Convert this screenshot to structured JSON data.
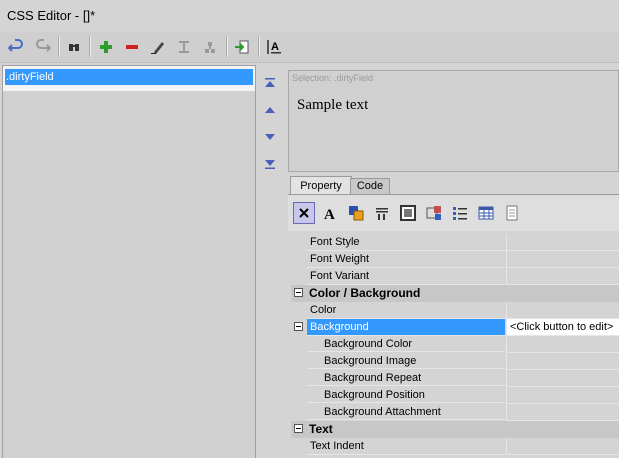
{
  "window": {
    "title": "CSS Editor - []*"
  },
  "toolbar": {
    "buttons": [
      "undo-icon",
      "redo-icon",
      "binoculars-icon",
      "add-icon",
      "remove-icon",
      "edit-icon",
      "tree-icon",
      "tree-disabled-icon",
      "import-icon",
      "font-style-icon"
    ]
  },
  "rules": {
    "items": [
      ".dirtyField"
    ]
  },
  "preview": {
    "selection_label": "Selection: .dirtyField",
    "sample_text": "Sample text"
  },
  "tabs": [
    {
      "label": "Property"
    },
    {
      "label": "Code"
    }
  ],
  "properties": {
    "rows": [
      {
        "type": "prop",
        "name": "Font Style",
        "value": ""
      },
      {
        "type": "prop",
        "name": "Font Weight",
        "value": ""
      },
      {
        "type": "prop",
        "name": "Font Variant",
        "value": ""
      },
      {
        "type": "cat",
        "name": "Color / Background"
      },
      {
        "type": "prop",
        "name": "Color",
        "value": ""
      },
      {
        "type": "group",
        "name": "Background",
        "value": "<Click button to edit>"
      },
      {
        "type": "sub",
        "name": "Background Color",
        "value": ""
      },
      {
        "type": "sub",
        "name": "Background Image",
        "value": ""
      },
      {
        "type": "sub",
        "name": "Background Repeat",
        "value": ""
      },
      {
        "type": "sub",
        "name": "Background Position",
        "value": ""
      },
      {
        "type": "sub",
        "name": "Background Attachment",
        "value": ""
      },
      {
        "type": "cat",
        "name": "Text"
      },
      {
        "type": "prop",
        "name": "Text Indent",
        "value": ""
      }
    ]
  },
  "colors": {
    "selection": "#3399ff",
    "category_bg": "#c7c7c7"
  }
}
